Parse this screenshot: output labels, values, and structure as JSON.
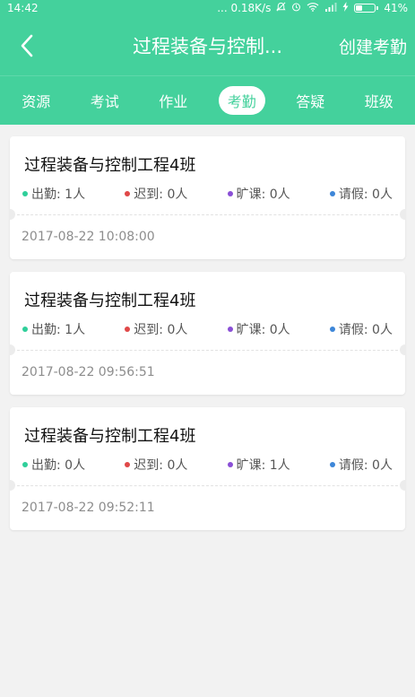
{
  "status_bar": {
    "time": "14:42",
    "network_speed": "... 0.18K/s",
    "icons": [
      "alarm-off-icon",
      "clock-icon",
      "wifi-icon",
      "signal-icon",
      "charging-icon"
    ],
    "battery": {
      "percent_text": "41%",
      "level": 0.41
    }
  },
  "colors": {
    "primary": "#44d19c",
    "dot_present": "#2fcf9a",
    "dot_late": "#e04848",
    "dot_absent": "#8a4fd6",
    "dot_leave": "#3d86d8"
  },
  "header": {
    "back_icon": "chevron-left-icon",
    "title": "过程装备与控制...",
    "action_label": "创建考勤"
  },
  "tabs": [
    {
      "label": "资源",
      "active": false
    },
    {
      "label": "考试",
      "active": false
    },
    {
      "label": "作业",
      "active": false
    },
    {
      "label": "考勤",
      "active": true
    },
    {
      "label": "答疑",
      "active": false
    },
    {
      "label": "班级",
      "active": false
    }
  ],
  "records": [
    {
      "title": "过程装备与控制工程4班",
      "stats": [
        {
          "label": "出勤: 1人",
          "color_key": "dot_present"
        },
        {
          "label": "迟到: 0人",
          "color_key": "dot_late"
        },
        {
          "label": "旷课: 0人",
          "color_key": "dot_absent"
        },
        {
          "label": "请假: 0人",
          "color_key": "dot_leave"
        }
      ],
      "time": "2017-08-22 10:08:00"
    },
    {
      "title": "过程装备与控制工程4班",
      "stats": [
        {
          "label": "出勤: 1人",
          "color_key": "dot_present"
        },
        {
          "label": "迟到: 0人",
          "color_key": "dot_late"
        },
        {
          "label": "旷课: 0人",
          "color_key": "dot_absent"
        },
        {
          "label": "请假: 0人",
          "color_key": "dot_leave"
        }
      ],
      "time": "2017-08-22 09:56:51"
    },
    {
      "title": "过程装备与控制工程4班",
      "stats": [
        {
          "label": "出勤: 0人",
          "color_key": "dot_present"
        },
        {
          "label": "迟到: 0人",
          "color_key": "dot_late"
        },
        {
          "label": "旷课: 1人",
          "color_key": "dot_absent"
        },
        {
          "label": "请假: 0人",
          "color_key": "dot_leave"
        }
      ],
      "time": "2017-08-22 09:52:11"
    }
  ]
}
